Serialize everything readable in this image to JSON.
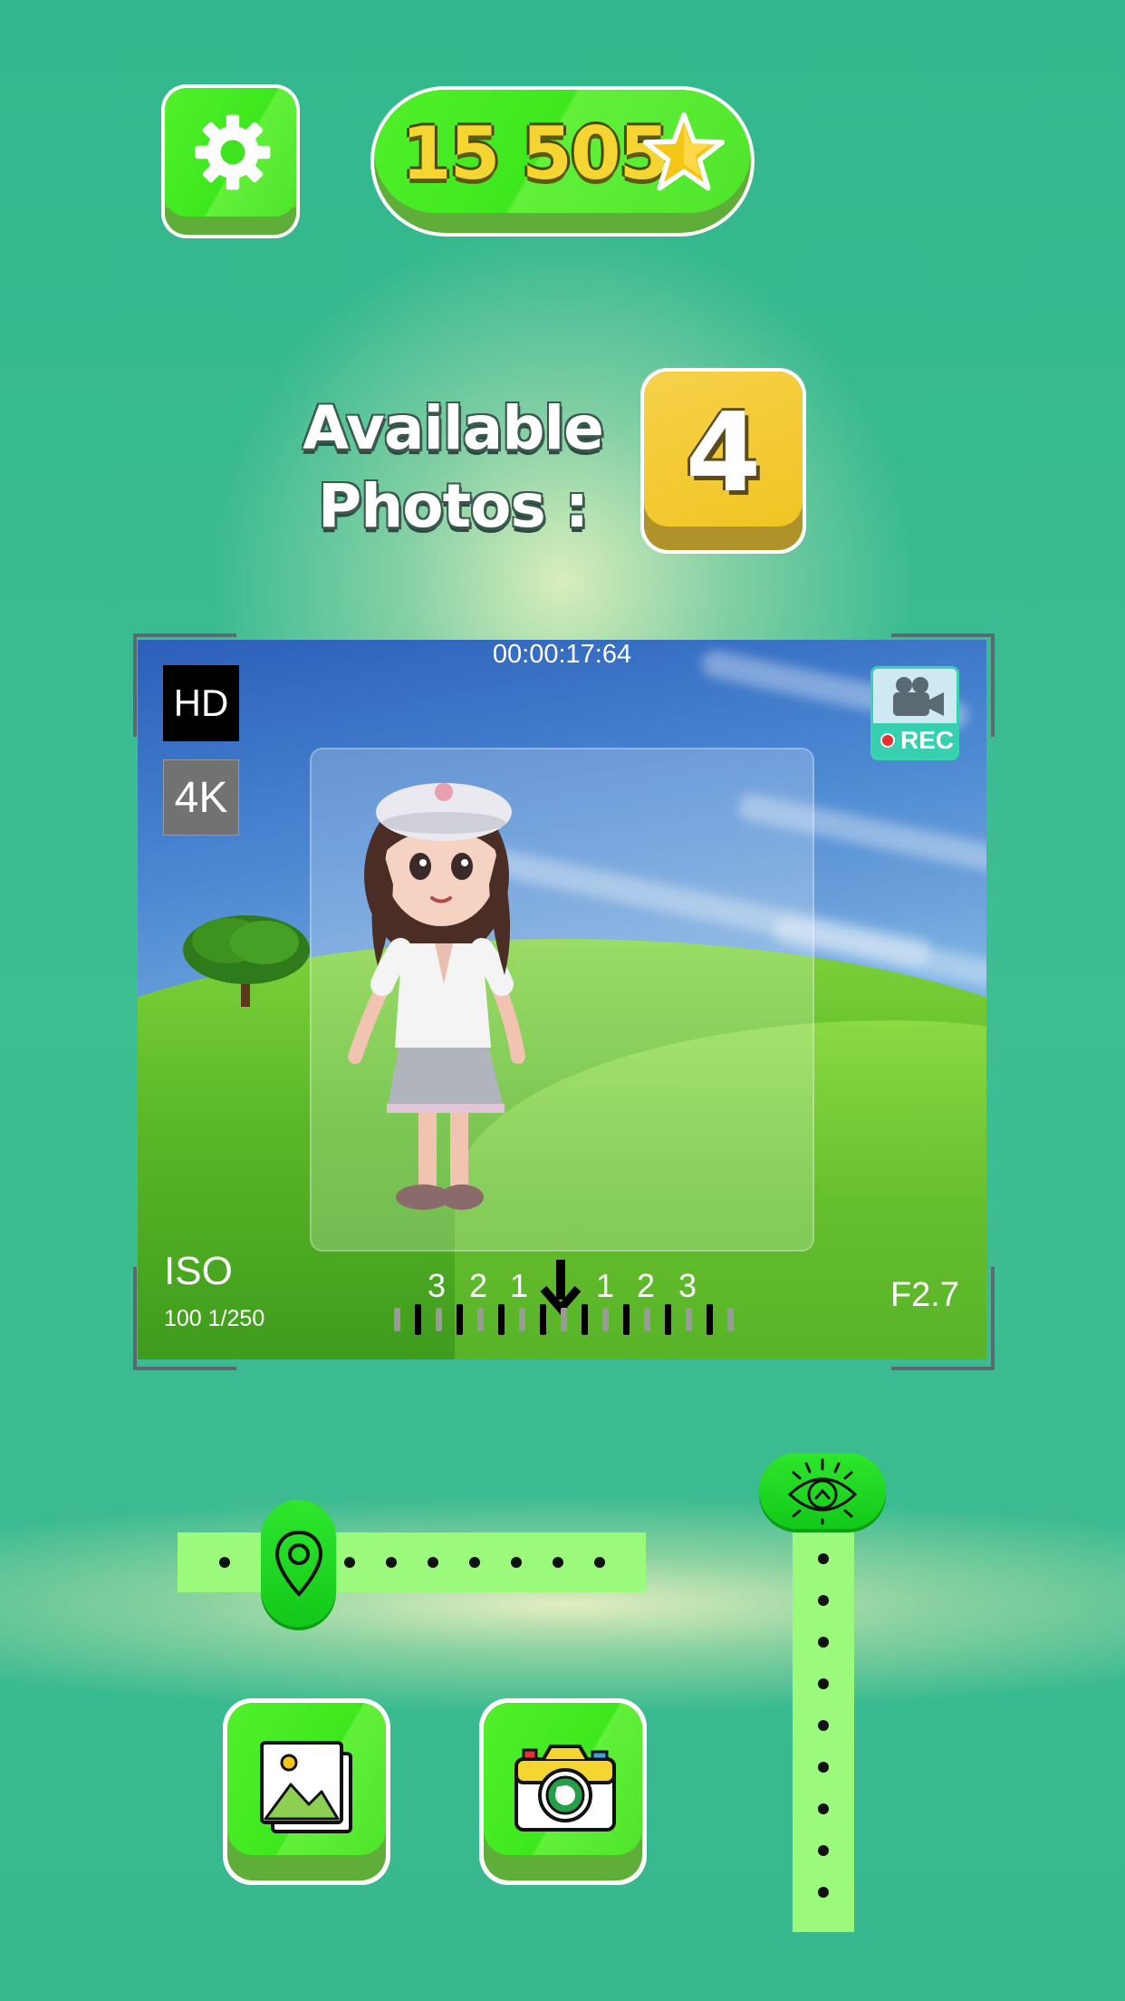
{
  "header": {
    "coins": "15 505"
  },
  "photos": {
    "label_line1": "Available",
    "label_line2": "Photos :",
    "count": "4"
  },
  "camera": {
    "timecode": "00:00:17:64",
    "quality_hd": "HD",
    "quality_4k": "4K",
    "rec_label": "REC",
    "iso_label": "ISO",
    "iso_value": "100 1/250",
    "aperture": "F2.7",
    "exposure_scale": [
      "3",
      "2",
      "1",
      "1",
      "2",
      "3"
    ]
  },
  "sliders": {
    "horizontal_position_fraction": 0.2,
    "vertical_position_fraction": 0.0
  },
  "colors": {
    "button_green": "#3de81d",
    "track_green": "#9bfa7b",
    "coin_yellow": "#f5d531",
    "count_gold": "#f0c423"
  },
  "icons": [
    "gear-icon",
    "star-icon",
    "videocam-icon",
    "tree-icon",
    "arrow-down-icon",
    "pin-icon",
    "eye-icon",
    "gallery-icon",
    "camera-icon"
  ]
}
